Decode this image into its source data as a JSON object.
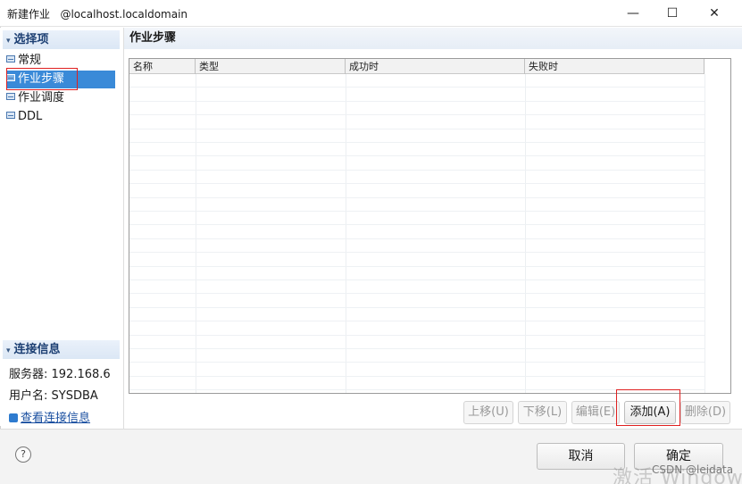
{
  "window": {
    "title": "新建作业   @localhost.localdomain",
    "minimize": "—",
    "maximize": "☐",
    "close": "✕"
  },
  "sidebar": {
    "options_header": "选择项",
    "items": [
      {
        "label": "常规"
      },
      {
        "label": "作业步骤"
      },
      {
        "label": "作业调度"
      },
      {
        "label": "DDL"
      }
    ],
    "conn_header": "连接信息",
    "server": "服务器: 192.168.6",
    "user": "用户名: SYSDBA",
    "view_conn": "查看连接信息"
  },
  "main": {
    "title": "作业步骤",
    "table": {
      "columns": [
        "名称",
        "类型",
        "成功时",
        "失败时"
      ],
      "rows": []
    },
    "actions": {
      "move_up": "上移(U)",
      "move_down": "下移(L)",
      "edit": "编辑(E)",
      "add": "添加(A)",
      "delete": "删除(D)"
    }
  },
  "footer": {
    "help": "?",
    "cancel": "取消",
    "ok": "确定",
    "watermark": "激活 Windows",
    "csdn": "CSDN @leidata"
  }
}
